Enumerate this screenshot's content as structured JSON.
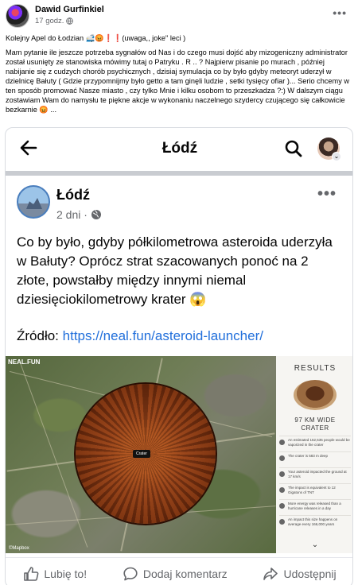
{
  "post": {
    "author": "Dawid Gurfinkiel",
    "time": "17 godz.",
    "title_line": "Kolejny Apel do Łodzian 🚅😡❗❗(uwaga,, joke\" leci )",
    "body": "Mam pytanie ile jeszcze potrzeba sygnałów od Nas i do czego musi dojść aby mizogeniczny administrator został usunięty ze stanowiska mówimy tutaj o Patryku . R .. ? Najpierw pisanie po murach , później nabijanie się z cudzych chorób psychicznych , dzisiaj symulacja co by było gdyby meteoryt uderzył w dzielnicę Bałuty ( Gdzie przypomnijmy było getto a tam ginęli ludzie , setki tysięcy ofiar )... Serio chcemy w ten sposób promować Nasze miasto , czy tylko Mnie i kilku osobom to przeszkadza ?:) W dalszym ciągu zostawiam Wam do namysłu te piękne akcje w wykonaniu naczelnego szydercy czującego się całkowicie bezkarnie 😡 ..."
  },
  "embed": {
    "header_title": "Łódź",
    "page_name": "Łódź",
    "page_time": "2 dni ·",
    "body": "Co by było, gdyby półkilometrowa asteroida uderzyła w Bałuty? Oprócz strat szacowanych ponoć na 2 złote, powstałby między innymi niemal dziesięciokilometrowy krater 😱",
    "source_label": "Źródło: ",
    "source_link": "https://neal.fun/asteroid-launcher/",
    "map": {
      "site_label": "NEAL.FUN",
      "crater_tag": "Crater",
      "logo": "©Mapbox"
    },
    "results": {
      "heading": "RESULTS",
      "crater_size": "97 KM WIDE",
      "crater_word": "CRATER",
      "rows": [
        "An estimated 162,535 people would be vaporized in the crater",
        "The crater is 583 m deep",
        "Your asteroid impacted the ground at 17 km/s",
        "The impact is equivalent to 12 Gigatons of TNT",
        "More energy was released than a hurricane releases in a day",
        "An impact this size happens on average every 166,000 years"
      ]
    },
    "actions": {
      "like": "Lubię to!",
      "comment": "Dodaj komentarz",
      "share": "Udostępnij"
    }
  },
  "colors": {
    "link": "#216fdb",
    "muted": "#65676b",
    "crater": "#8c3c16"
  }
}
